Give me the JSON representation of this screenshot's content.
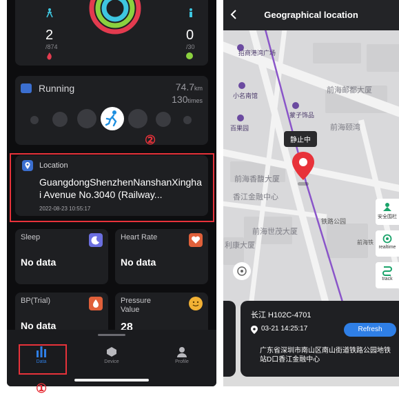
{
  "annotations": {
    "marker1": "①",
    "marker2": "②"
  },
  "left": {
    "stats": {
      "steps_value": "2",
      "steps_goal": "/874",
      "minutes_value": "0",
      "minutes_goal": "/30"
    },
    "running": {
      "label": "Running",
      "distance": "74.7",
      "distance_unit": "km",
      "count": "130",
      "count_unit": "times"
    },
    "location": {
      "label": "Location",
      "address": "GuangdongShenzhenNanshanXinghai Avenue No.3040 (Railway...",
      "timestamp": "2022-08-23 10:55:17"
    },
    "sleep": {
      "label": "Sleep",
      "value": "No data"
    },
    "heart_rate": {
      "label": "Heart Rate",
      "value": "No data"
    },
    "bp": {
      "label": "BP(Trial)",
      "value": "No data"
    },
    "pressure": {
      "label": "Pressure Value",
      "value": "28"
    },
    "tabs": [
      {
        "label": "Data",
        "icon": "bar-chart-icon",
        "active": true
      },
      {
        "label": "Device",
        "icon": "device-icon",
        "active": false
      },
      {
        "label": "Profile",
        "icon": "person-icon",
        "active": false
      }
    ]
  },
  "right": {
    "title": "Geographical location",
    "marker_bubble": "静止中",
    "map_labels": {
      "a": "前海邮都大厦",
      "b": "前海颐湾",
      "c": "前海香馥大厦",
      "d": "香江金融中心",
      "e": "前海世茂大厦",
      "f": "利康大厦",
      "g": "铁路公园",
      "h": "前海铁"
    },
    "pois": {
      "p1": "招商港湾广场",
      "p2": "小名南馆",
      "p3": "蒙子饰品",
      "p4": "百果园"
    },
    "side_buttons": [
      {
        "label": "安全围栏",
        "icon": "fence-icon"
      },
      {
        "label": "realtime",
        "icon": "target-icon"
      },
      {
        "label": "track",
        "icon": "track-icon"
      }
    ],
    "panel": {
      "device": "长江  H102C-4701",
      "time": "03-21 14:25:17",
      "refresh": "Refresh",
      "address": "广东省深圳市南山区南山街道铁路公园地铁站D口香江金融中心"
    },
    "colors": {
      "accent": "#e8323a",
      "refresh": "#2f7fe6",
      "route": "#8a55c9"
    }
  }
}
